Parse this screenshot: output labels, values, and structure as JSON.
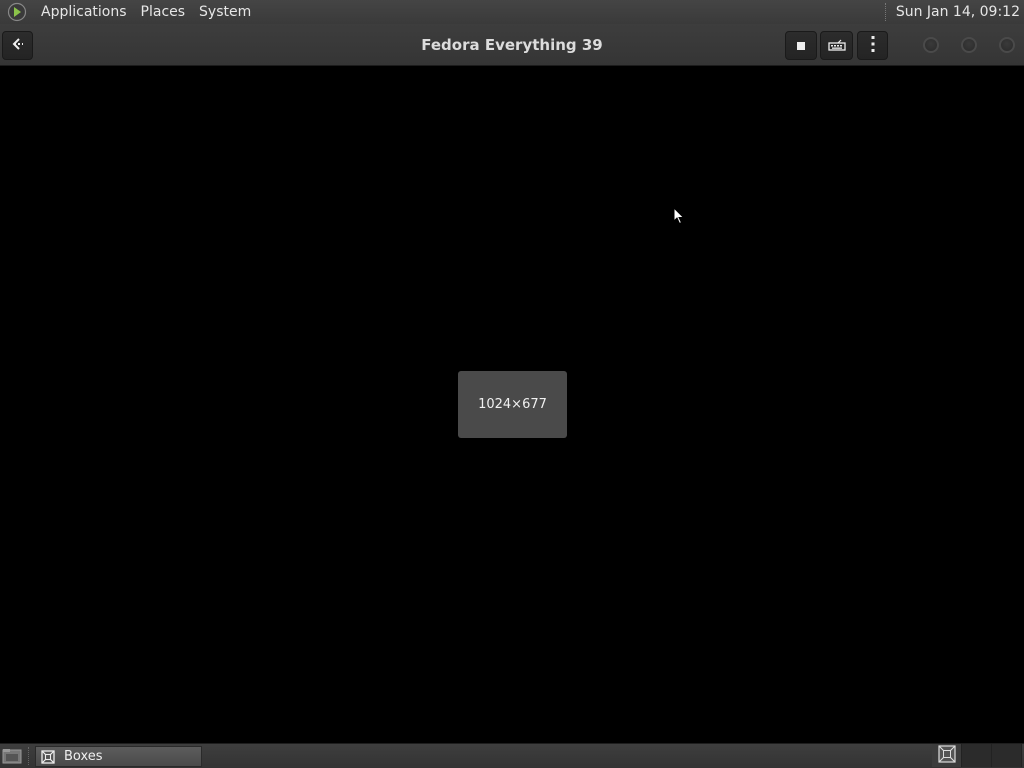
{
  "top_panel": {
    "menus": [
      "Applications",
      "Places",
      "System"
    ],
    "clock": "Sun Jan 14, 09:12"
  },
  "header": {
    "title": "Fedora Everything 39"
  },
  "display": {
    "size_label": "1024×677"
  },
  "taskbar": {
    "window_label": "Boxes"
  },
  "icons": {
    "logo": "distro-logo-icon",
    "back": "back-arrow-icon",
    "stop": "stop-icon",
    "keyboard": "keyboard-icon",
    "menu": "vertical-dots-menu-icon",
    "show_desktop": "show-desktop-icon",
    "task": "boxes-app-icon",
    "workspace": "workspace-icon"
  },
  "colors": {
    "panel_bg": "#3a3a3a",
    "header_bg": "#383838",
    "display_bg": "#000000",
    "overlay_bg": "#4a4a4a"
  }
}
